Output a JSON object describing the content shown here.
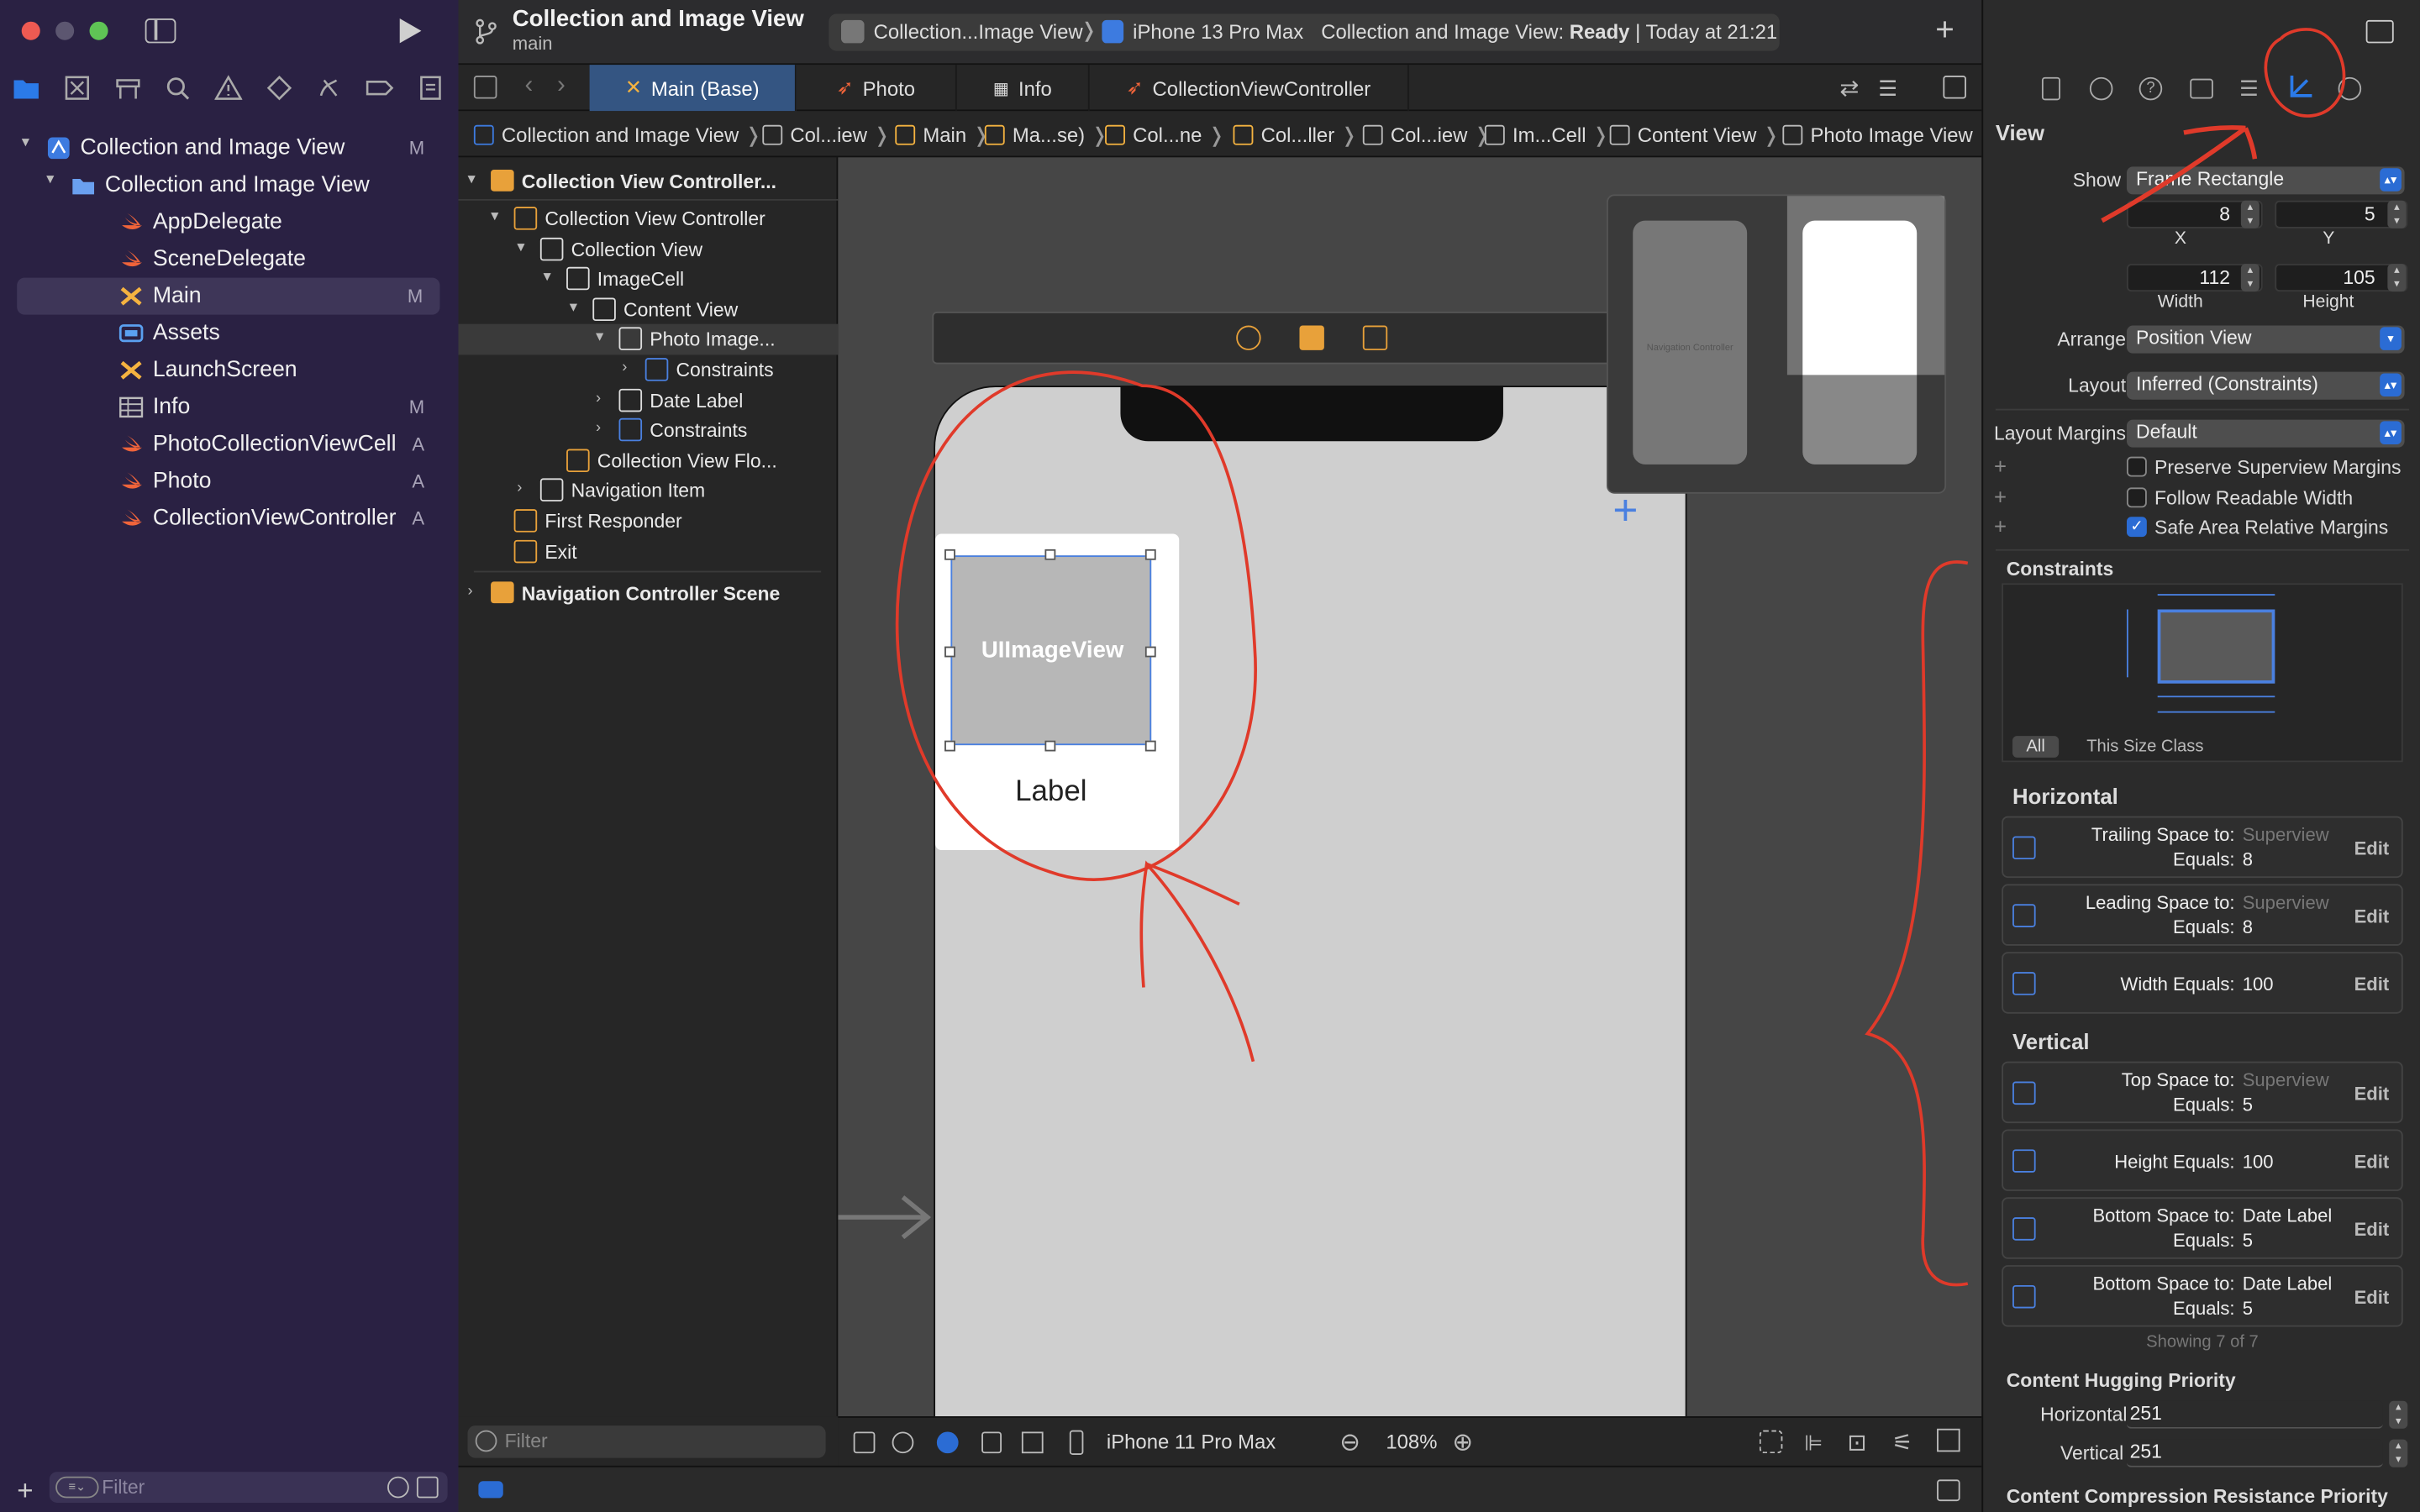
{
  "sidebar": {
    "items": [
      {
        "label": "Collection and Image View",
        "badge": "M",
        "icon": "xcode-project-icon"
      },
      {
        "label": "Collection and Image View",
        "badge": "",
        "icon": "folder-icon"
      },
      {
        "label": "AppDelegate",
        "badge": "",
        "icon": "swift-icon"
      },
      {
        "label": "SceneDelegate",
        "badge": "",
        "icon": "swift-icon"
      },
      {
        "label": "Main",
        "badge": "M",
        "icon": "storyboard-icon"
      },
      {
        "label": "Assets",
        "badge": "",
        "icon": "assets-icon"
      },
      {
        "label": "LaunchScreen",
        "badge": "",
        "icon": "storyboard-icon"
      },
      {
        "label": "Info",
        "badge": "M",
        "icon": "plist-icon"
      },
      {
        "label": "PhotoCollectionViewCell",
        "badge": "A",
        "icon": "swift-icon"
      },
      {
        "label": "Photo",
        "badge": "A",
        "icon": "swift-icon"
      },
      {
        "label": "CollectionViewController",
        "badge": "A",
        "icon": "swift-icon"
      }
    ],
    "filter_placeholder": "Filter"
  },
  "toolbar": {
    "project_title": "Collection and Image View",
    "branch": "main",
    "scheme": "Collection...Image View",
    "device": "iPhone 13 Pro Max",
    "status_prefix": "Collection and Image View: ",
    "status_state": "Ready",
    "status_time": "| Today at 21:21"
  },
  "tabs": [
    "Main (Base)",
    "Photo",
    "Info",
    "CollectionViewController"
  ],
  "jumpbar": [
    "Collection and Image View",
    "Col...iew",
    "Main",
    "Ma...se)",
    "Col...ne",
    "Col...ller",
    "Col...iew",
    "Im...Cell",
    "Content View",
    "Photo Image View"
  ],
  "outline": {
    "scene_title": "Collection View Controller...",
    "rows": [
      "Collection View Controller",
      "Collection View",
      "ImageCell",
      "Content View",
      "Photo Image...",
      "Constraints",
      "Date Label",
      "Constraints",
      "Collection View Flo...",
      "Navigation Item",
      "First Responder",
      "Exit"
    ],
    "nav_scene": "Navigation Controller Scene",
    "filter_placeholder": "Filter"
  },
  "canvas": {
    "image_view_label": "UIImageView",
    "cell_label": "Label",
    "minimap_label": "Navigation Controller"
  },
  "canvasbar": {
    "device": "iPhone 11 Pro Max",
    "zoom": "108%"
  },
  "inspector": {
    "header": "View",
    "show_label": "Show",
    "show_value": "Frame Rectangle",
    "x_value": "8",
    "y_value": "5",
    "x_label": "X",
    "y_label": "Y",
    "width_value": "112",
    "height_value": "105",
    "width_label": "Width",
    "height_label": "Height",
    "arrange_label": "Arrange",
    "arrange_value": "Position View",
    "layout_label": "Layout",
    "layout_value": "Inferred (Constraints)",
    "margins_label": "Layout Margins",
    "margins_value": "Default",
    "checkbox_1": "Preserve Superview Margins",
    "checkbox_2": "Follow Readable Width",
    "checkbox_3": "Safe Area Relative Margins",
    "constraints_title": "Constraints",
    "seg_all": "All",
    "seg_size_class": "This Size Class",
    "horizontal_title": "Horizontal",
    "vertical_title": "Vertical",
    "edit": "Edit",
    "equals": "Equals:",
    "h_constraints": [
      {
        "key": "Trailing Space to:",
        "target": "Superview",
        "value": "8"
      },
      {
        "key": "Leading Space to:",
        "target": "Superview",
        "value": "8"
      },
      {
        "key": "Width Equals:",
        "target": "",
        "value": "100"
      }
    ],
    "v_constraints": [
      {
        "key": "Top Space to:",
        "target": "Superview",
        "value": "5"
      },
      {
        "key": "Height Equals:",
        "target": "",
        "value": "100"
      },
      {
        "key": "Bottom Space to:",
        "target": "Date Label",
        "value": "5"
      },
      {
        "key": "Bottom Space to:",
        "target": "Date Label",
        "value": "5"
      }
    ],
    "showing": "Showing 7 of 7",
    "hugging_title": "Content Hugging Priority",
    "hugging_h_label": "Horizontal",
    "hugging_h_value": "251",
    "hugging_v_label": "Vertical",
    "hugging_v_value": "251",
    "compression_title": "Content Compression Resistance Priority"
  },
  "colors": {
    "sidebar_bg": "#2a2143",
    "accent": "#2b6cd4",
    "annotation": "#e03a2a",
    "swift": "#f0643a",
    "storyboard": "#f5b340"
  }
}
